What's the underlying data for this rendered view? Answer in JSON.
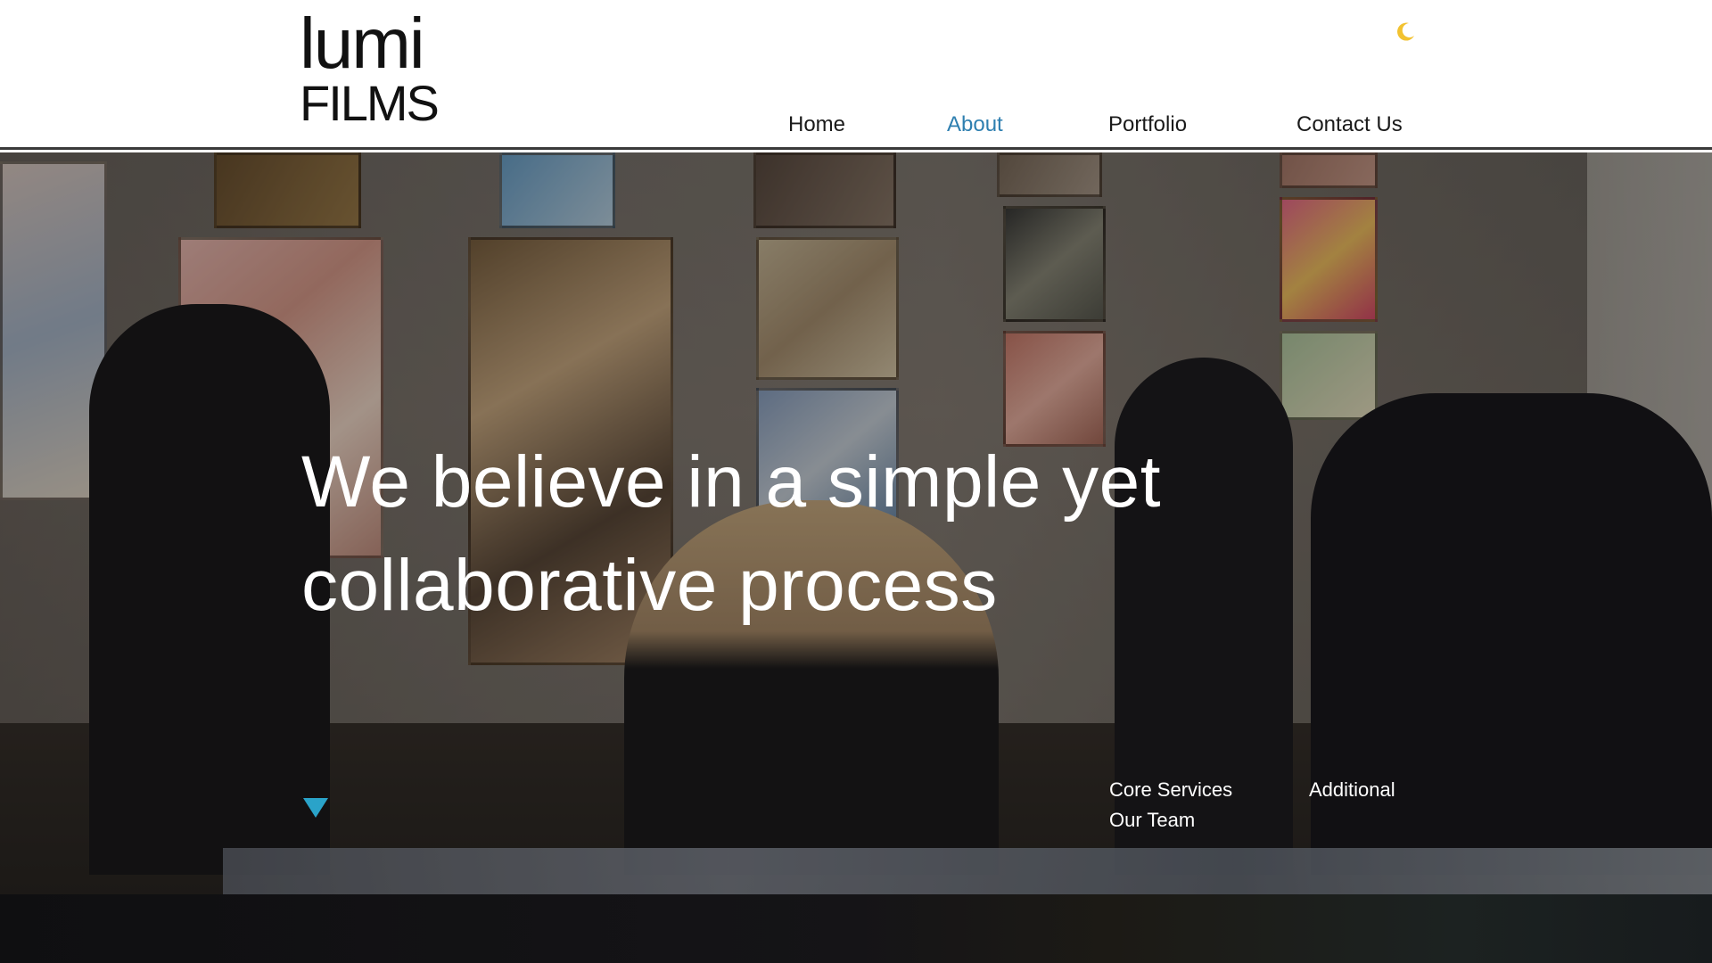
{
  "header": {
    "logo_top": "lumi",
    "logo_bottom": "FILMS",
    "theme_icon": "moon-icon",
    "theme_icon_color": "#f2c230"
  },
  "nav": {
    "items": [
      {
        "label": "Home",
        "active": false
      },
      {
        "label": "About",
        "active": true
      },
      {
        "label": "Portfolio",
        "active": false
      },
      {
        "label": "Contact Us",
        "active": false
      }
    ],
    "active_color": "#2e7fb0"
  },
  "hero": {
    "title_line1": "We believe in a simple yet",
    "title_line2": "collaborative process",
    "scroll_icon": "triangle-down-icon",
    "scroll_icon_color": "#2aa3c9",
    "links_left": [
      "Core Services",
      "Our Team"
    ],
    "links_right": [
      "Additional"
    ]
  }
}
